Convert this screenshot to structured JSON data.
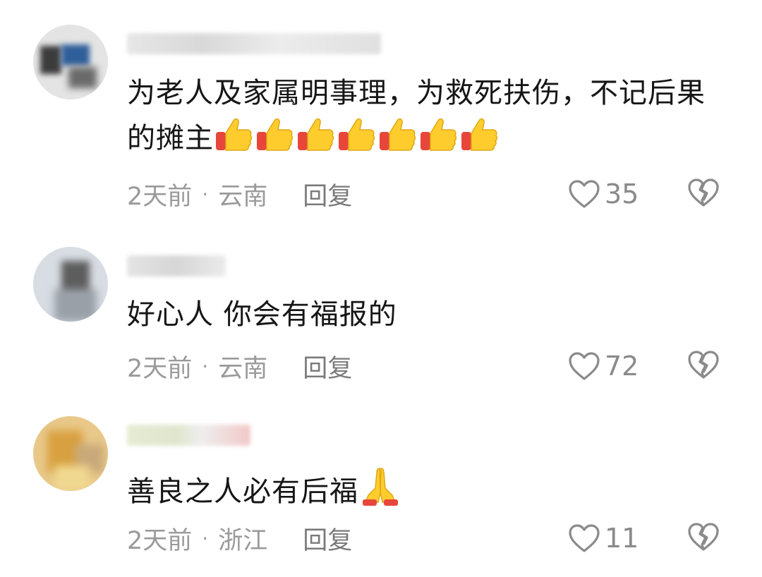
{
  "colors": {
    "text_primary": "#161616",
    "text_meta": "#9a9a9a",
    "icon_stroke": "#8a8a8a",
    "emoji_yellow": "#ffcc2e",
    "emoji_red": "#e8463a"
  },
  "comments": [
    {
      "text": "为老人及家属明事理，为救死扶伤，不记后果的摊主",
      "emoji": "thumbs-up",
      "emoji_count": 7,
      "time": "2天前",
      "location": "云南",
      "reply_label": "回复",
      "likes": "35",
      "avatar_icon": "avatar-blurred"
    },
    {
      "text": "好心人 你会有福报的",
      "emoji": "",
      "emoji_count": 0,
      "time": "2天前",
      "location": "云南",
      "reply_label": "回复",
      "likes": "72",
      "avatar_icon": "avatar-blurred"
    },
    {
      "text": "善良之人必有后福",
      "emoji": "folded-hands",
      "emoji_count": 1,
      "time": "2天前",
      "location": "浙江",
      "reply_label": "回复",
      "likes": "11",
      "avatar_icon": "avatar-blurred"
    }
  ],
  "icons": {
    "like": "heart-outline-icon",
    "dislike": "broken-heart-icon"
  }
}
